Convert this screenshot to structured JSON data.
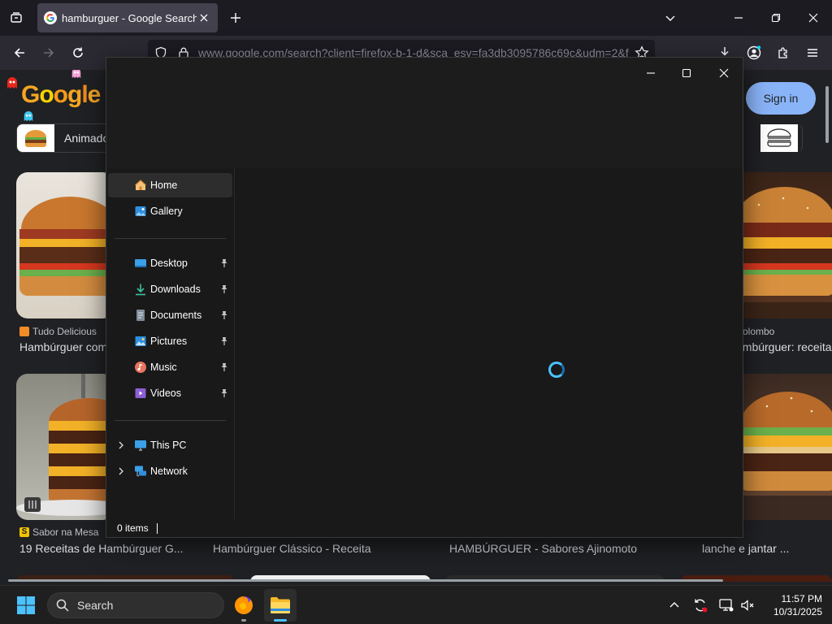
{
  "browser": {
    "tab_title": "hamburguer - Google Search",
    "url": "www.google.com/search?client=firefox-b-1-d&sca_esv=fa3db3095786c69c&udm=2&f"
  },
  "google": {
    "logo_letters": [
      "G",
      "o",
      "o",
      "g",
      "l",
      "e"
    ],
    "sign_in_label": "Sign in",
    "chip_label": "Animado",
    "results": [
      {
        "source": "Tudo Delicious",
        "caption": "Hambúrguer com"
      },
      {
        "source": "olombo",
        "caption": "ambúrguer: receita"
      },
      {
        "source": "Sabor na Mesa",
        "caption": "19 Receitas de Hambúrguer G..."
      },
      {
        "source": "",
        "caption": "Hambúrguer Clássico - Receita"
      },
      {
        "source": "",
        "caption": "HAMBÚRGUER - Sabores Ajinomoto"
      },
      {
        "source": "",
        "caption": "lanche e jantar ..."
      }
    ]
  },
  "explorer": {
    "nav_items": [
      {
        "label": "Home",
        "icon": "home-icon"
      },
      {
        "label": "Gallery",
        "icon": "gallery-icon"
      },
      {
        "label": "Desktop",
        "icon": "desktop-icon",
        "pinned": true
      },
      {
        "label": "Downloads",
        "icon": "downloads-icon",
        "pinned": true
      },
      {
        "label": "Documents",
        "icon": "documents-icon",
        "pinned": true
      },
      {
        "label": "Pictures",
        "icon": "pictures-icon",
        "pinned": true
      },
      {
        "label": "Music",
        "icon": "music-icon",
        "pinned": true
      },
      {
        "label": "Videos",
        "icon": "videos-icon",
        "pinned": true
      },
      {
        "label": "This PC",
        "icon": "this-pc-icon"
      },
      {
        "label": "Network",
        "icon": "network-icon"
      }
    ],
    "status_text": "0 items"
  },
  "taskbar": {
    "search_label": "Search",
    "time": "11:57 PM",
    "date": "10/31/2025"
  },
  "colors": {
    "accent": "#8ab4f8",
    "spinner": "#4cc2ff",
    "explorer_bg": "#191919",
    "google_bg": "#202124"
  }
}
